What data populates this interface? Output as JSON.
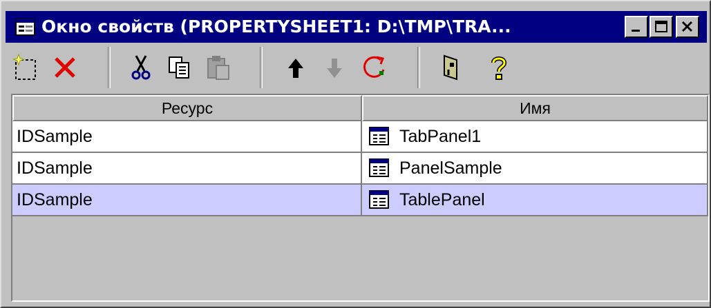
{
  "window": {
    "title": "Окно свойств (PROPERTYSHEET1: D:\\TMP\\TRA...",
    "controls": [
      "minimize-button",
      "maximize-button",
      "close-button"
    ]
  },
  "toolbar": {
    "tools": [
      {
        "name": "new-icon",
        "enabled": true
      },
      {
        "name": "delete-icon",
        "enabled": true
      },
      {
        "name": "cut-icon",
        "enabled": true
      },
      {
        "name": "copy-icon",
        "enabled": true
      },
      {
        "name": "paste-icon",
        "enabled": false
      },
      {
        "name": "move-up-icon",
        "enabled": true
      },
      {
        "name": "move-down-icon",
        "enabled": false
      },
      {
        "name": "refresh-icon",
        "enabled": true
      },
      {
        "name": "properties-icon",
        "enabled": true
      },
      {
        "name": "help-icon",
        "enabled": true
      }
    ]
  },
  "table": {
    "headers": {
      "resource": "Ресурс",
      "name": "Имя"
    },
    "rows": [
      {
        "resource": "IDSample",
        "name": "TabPanel1",
        "selected": false
      },
      {
        "resource": "IDSample",
        "name": "PanelSample",
        "selected": false
      },
      {
        "resource": "IDSample",
        "name": "TablePanel",
        "selected": true
      }
    ]
  },
  "colors": {
    "titlebar": "#000080",
    "selection": "#ccccff",
    "face": "#c0c0c0"
  }
}
